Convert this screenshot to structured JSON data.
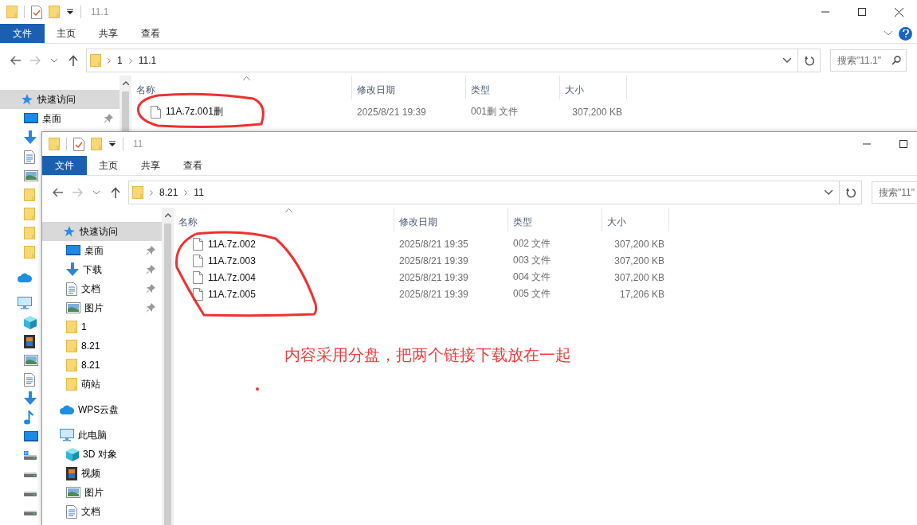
{
  "windows": [
    {
      "title": "11.1",
      "ribbon_tabs": [
        {
          "label": "文件",
          "selected": true
        },
        {
          "label": "主页",
          "selected": false
        },
        {
          "label": "共享",
          "selected": false
        },
        {
          "label": "查看",
          "selected": false
        }
      ],
      "path": [
        "1",
        "11.1"
      ],
      "search": {
        "placeholder": "搜索\"11.1\""
      },
      "nav": [
        {
          "label": "快速访问",
          "kind": "star",
          "selected": true,
          "children": [
            {
              "label": "桌面",
              "kind": "desktop",
              "pinned": true,
              "selected": false
            },
            {
              "kind": "download",
              "selected": false
            },
            {
              "kind": "document",
              "selected": false
            },
            {
              "kind": "picture",
              "selected": false
            },
            {
              "kind": "folder",
              "selected": false
            },
            {
              "kind": "folder",
              "selected": false
            },
            {
              "kind": "folder",
              "selected": false
            },
            {
              "kind": "folder",
              "selected": false
            }
          ]
        },
        {
          "kind": "cloud",
          "selected": false
        },
        {
          "kind": "computer",
          "selected": false,
          "children": [
            {
              "kind": "cube",
              "selected": false
            },
            {
              "kind": "film",
              "selected": false
            },
            {
              "kind": "picture",
              "selected": false
            },
            {
              "kind": "document",
              "selected": false
            },
            {
              "kind": "download",
              "selected": false
            },
            {
              "kind": "music",
              "selected": false
            },
            {
              "kind": "desktop",
              "selected": false
            },
            {
              "kind": "drive-win",
              "selected": false
            },
            {
              "kind": "drive",
              "selected": false
            },
            {
              "kind": "drive",
              "selected": false
            },
            {
              "kind": "drive",
              "selected": false
            }
          ]
        }
      ],
      "columns": [
        "名称",
        "修改日期",
        "类型",
        "大小"
      ],
      "files": [
        {
          "name": "11A.7z.001删",
          "modified": "2025/8/21 19:39",
          "type": "001删 文件",
          "size": "307,200 KB"
        }
      ]
    },
    {
      "title": "11",
      "ribbon_tabs": [
        {
          "label": "文件",
          "selected": true
        },
        {
          "label": "主页",
          "selected": false
        },
        {
          "label": "共享",
          "selected": false
        },
        {
          "label": "查看",
          "selected": false
        }
      ],
      "path": [
        "8.21",
        "11"
      ],
      "search": {
        "placeholder": "搜索\"11\""
      },
      "nav": [
        {
          "label": "快速访问",
          "kind": "star",
          "selected": true,
          "children": [
            {
              "label": "桌面",
              "kind": "desktop",
              "pinned": true,
              "selected": false
            },
            {
              "label": "下载",
              "kind": "download",
              "pinned": true,
              "selected": false
            },
            {
              "label": "文档",
              "kind": "document",
              "pinned": true,
              "selected": false
            },
            {
              "label": "图片",
              "kind": "picture",
              "pinned": true,
              "selected": false
            },
            {
              "label": "1",
              "kind": "folder",
              "pinned": false,
              "selected": false
            },
            {
              "label": "8.21",
              "kind": "folder",
              "pinned": false,
              "selected": false
            },
            {
              "label": "8.21",
              "kind": "folder",
              "pinned": false,
              "selected": false
            },
            {
              "label": "萌站",
              "kind": "folder",
              "pinned": false,
              "selected": false
            }
          ]
        },
        {
          "label": "WPS云盘",
          "kind": "cloud",
          "selected": false
        },
        {
          "label": "此电脑",
          "kind": "computer",
          "selected": false,
          "children": [
            {
              "label": "3D 对象",
              "kind": "cube",
              "selected": false
            },
            {
              "label": "视频",
              "kind": "film",
              "selected": false
            },
            {
              "label": "图片",
              "kind": "picture",
              "selected": false
            },
            {
              "label": "文档",
              "kind": "document",
              "selected": false
            }
          ]
        }
      ],
      "columns": [
        "名称",
        "修改日期",
        "类型",
        "大小"
      ],
      "files": [
        {
          "name": "11A.7z.002",
          "modified": "2025/8/21 19:35",
          "type": "002 文件",
          "size": "307,200 KB"
        },
        {
          "name": "11A.7z.003",
          "modified": "2025/8/21 19:39",
          "type": "003 文件",
          "size": "307,200 KB"
        },
        {
          "name": "11A.7z.004",
          "modified": "2025/8/21 19:39",
          "type": "004 文件",
          "size": "307,200 KB"
        },
        {
          "name": "11A.7z.005",
          "modified": "2025/8/21 19:39",
          "type": "005 文件",
          "size": "17,206 KB"
        }
      ]
    }
  ],
  "annotation": {
    "note": "内容采用分盘，把两个链接下载放在一起"
  }
}
